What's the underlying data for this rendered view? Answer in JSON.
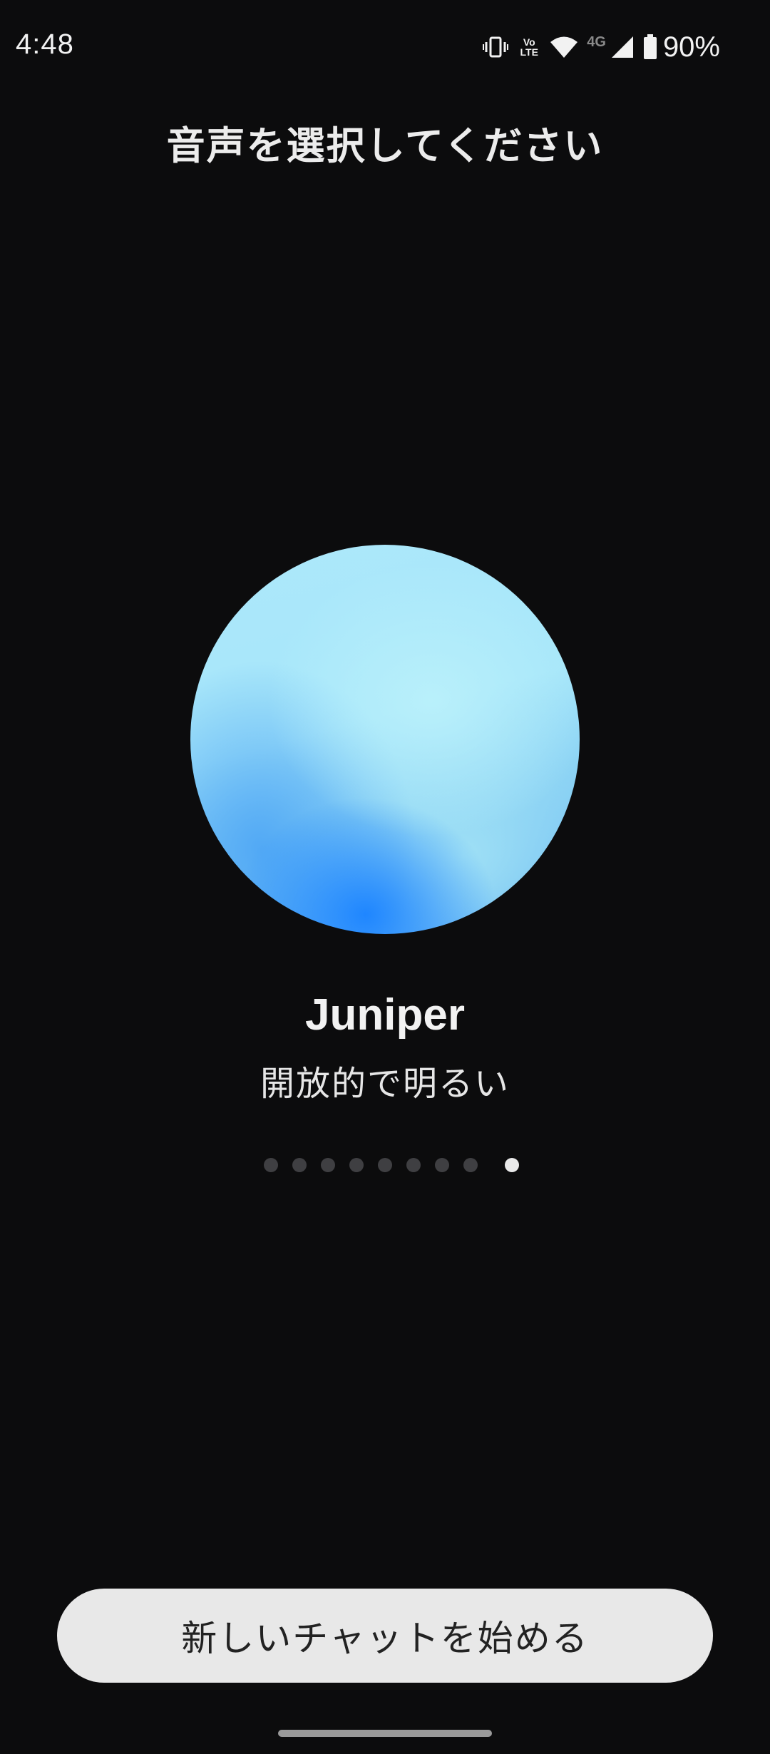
{
  "status_bar": {
    "time": "4:48",
    "volte_top": "Vo",
    "volte_bottom": "LTE",
    "network": "4G",
    "battery": "90%",
    "icons": [
      "vibrate-icon",
      "volte-icon",
      "wifi-icon",
      "signal-icon",
      "battery-icon"
    ]
  },
  "header": {
    "title": "音声を選択してください"
  },
  "voice": {
    "name": "Juniper",
    "description": "開放的で明るい",
    "orb_colors": [
      "#b9f0fb",
      "#7ec9f3",
      "#1f86ff"
    ]
  },
  "pager": {
    "total": 9,
    "current": 9
  },
  "actions": {
    "start_label": "新しいチャットを始める"
  },
  "colors": {
    "background": "#0c0c0d",
    "button_bg": "#e8e8e8",
    "button_text": "#222222",
    "dot_inactive": "#3f3f42",
    "dot_active": "#e9e9e9"
  }
}
